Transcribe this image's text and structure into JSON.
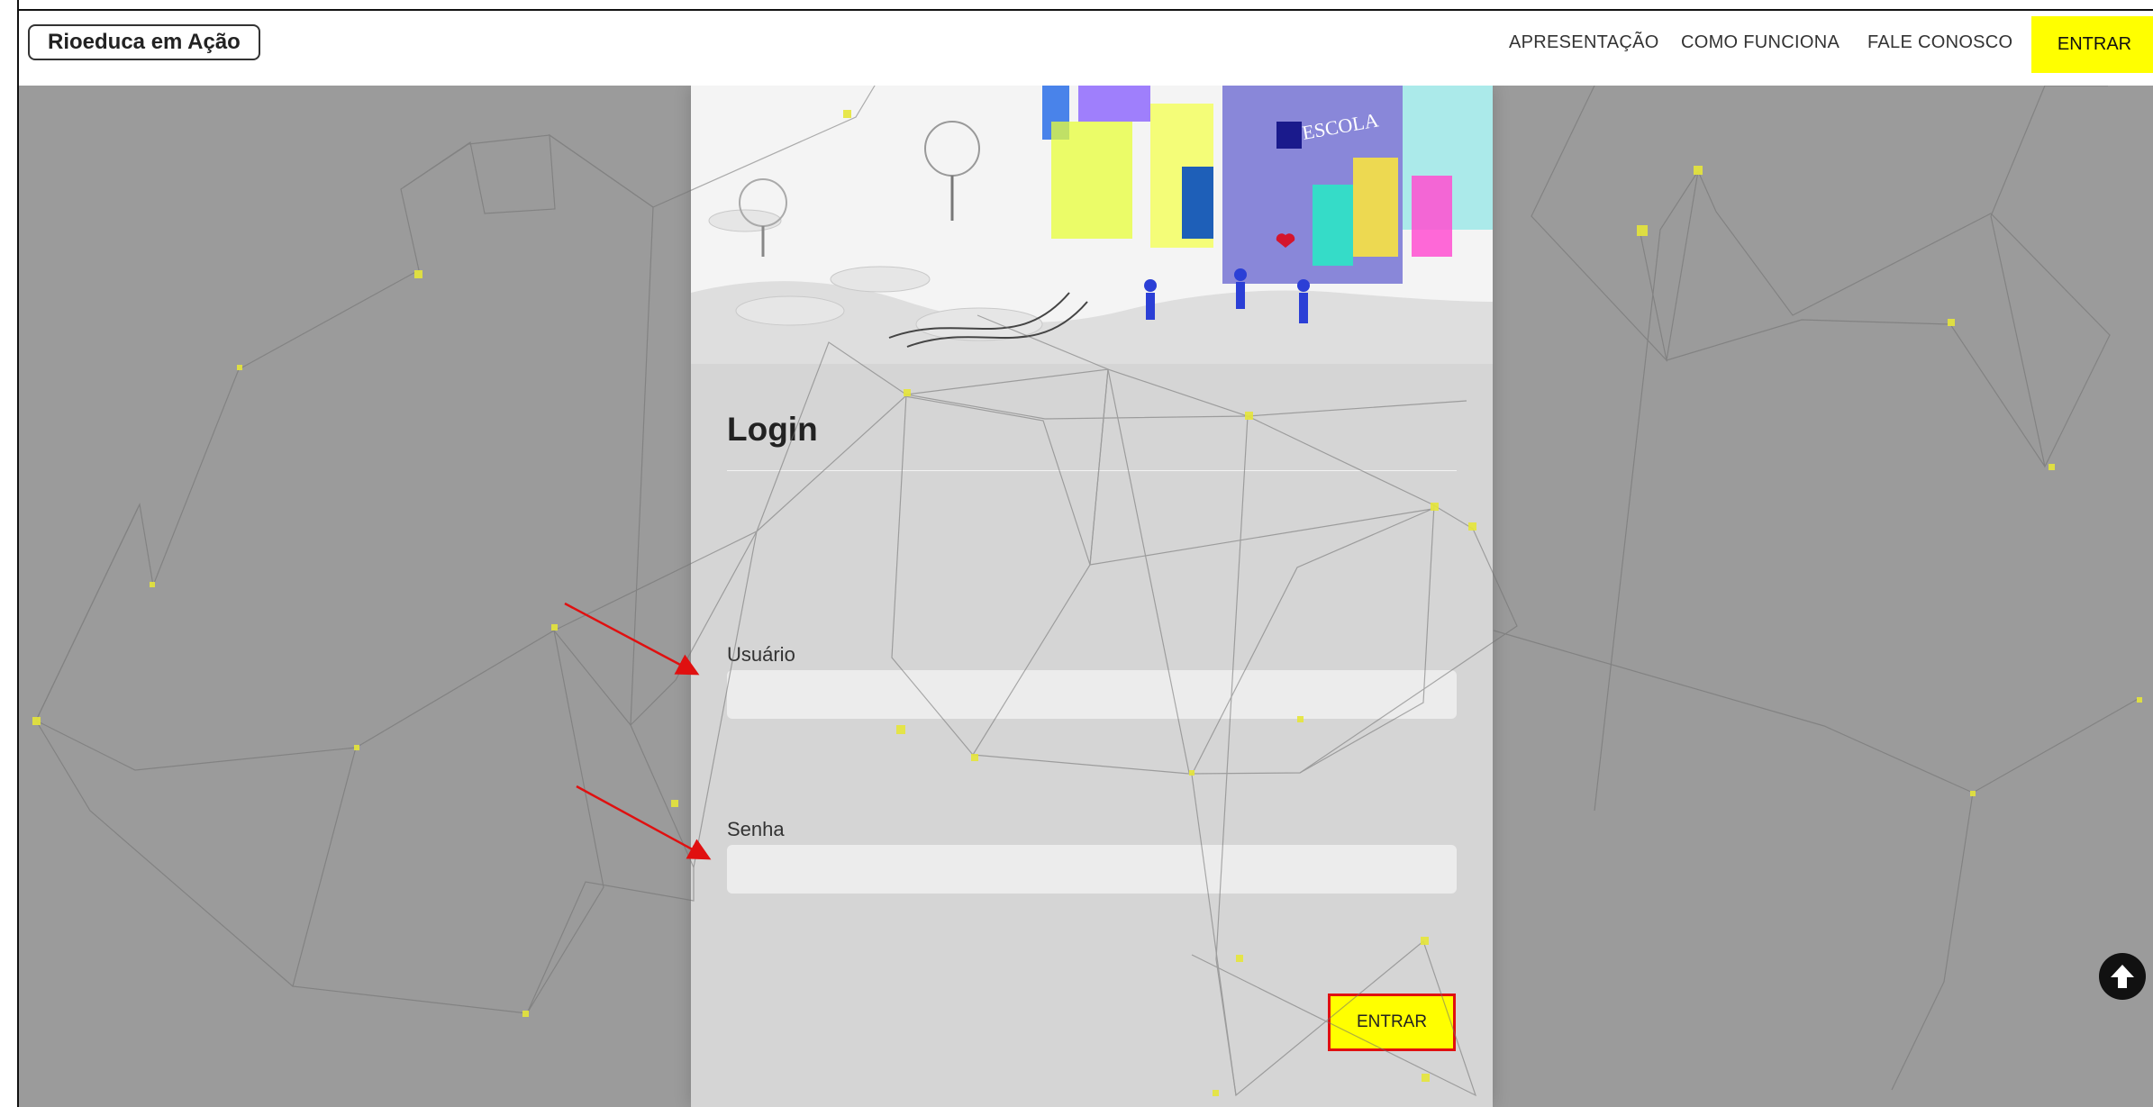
{
  "brand": {
    "title": "Rioeduca em Ação"
  },
  "nav": {
    "items": [
      "APRESENTAÇÃO",
      "COMO FUNCIONA",
      "FALE CONOSCO"
    ],
    "enter_label": "ENTRAR"
  },
  "hero": {
    "school_sign": "ESCOLA"
  },
  "login": {
    "title": "Login",
    "user_label": "Usuário",
    "user_value": "",
    "password_label": "Senha",
    "password_value": "",
    "submit_label": "ENTRAR"
  },
  "colors": {
    "accent": "#ffff00",
    "background": "#9b9b9b",
    "card": "#d5d5d5",
    "annotation": "#e01010"
  },
  "icons": {
    "scroll_top": "arrow-up-circle-icon"
  }
}
